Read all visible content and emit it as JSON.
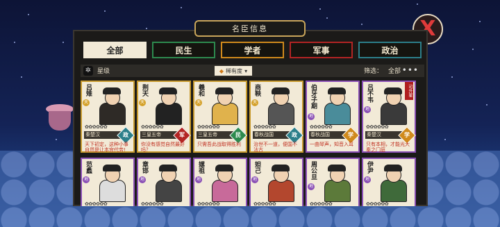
{
  "title": "名臣信息",
  "tabs": [
    {
      "label": "全部",
      "active": true,
      "color": "#f2ead7"
    },
    {
      "label": "民生",
      "active": false,
      "color": "#2d8a4e"
    },
    {
      "label": "学者",
      "active": false,
      "color": "#d08a1c"
    },
    {
      "label": "军事",
      "active": false,
      "color": "#b32424"
    },
    {
      "label": "政治",
      "active": false,
      "color": "#2c7f8a"
    }
  ],
  "filter": {
    "star_label": "星级",
    "sort_label": "稀有度",
    "screen_label": "筛选：",
    "screen_value": "全部",
    "more": "•••"
  },
  "cards": [
    {
      "name": "吕雉",
      "grade": "天",
      "period": "秦楚汉",
      "category": "政",
      "quote": "天下初定，这种小事自然是让本宫代劳!",
      "border": "#c79a2e",
      "cat_color": "#2c7f8a",
      "robe": "#2e2a26",
      "stars": "✿✿✿✿✿✿",
      "ribbon": ""
    },
    {
      "name": "荆天",
      "grade": "天",
      "period": "三皇五帝",
      "category": "军",
      "quote": "你没有感觉自然最好吗？",
      "border": "#c79a2e",
      "cat_color": "#b32424",
      "robe": "#222",
      "stars": "✿✿✿✿✿✿",
      "ribbon": ""
    },
    {
      "name": "羲和",
      "grade": "天",
      "period": "三皇五帝",
      "category": "民",
      "quote": "只需吾此战取得胜利",
      "border": "#c79a2e",
      "cat_color": "#2d8a4e",
      "robe": "#e0b24c",
      "stars": "✿✿✿✿✿✿",
      "ribbon": ""
    },
    {
      "name": "商鞅",
      "grade": "天",
      "period": "春秋战国",
      "category": "政",
      "quote": "治世不一道，便国不法古",
      "border": "#c79a2e",
      "cat_color": "#2c7f8a",
      "robe": "#555",
      "stars": "✿✿✿✿✿✿",
      "ribbon": ""
    },
    {
      "name": "伯牙子期",
      "grade": "地",
      "period": "春秋战国",
      "category": "学",
      "quote": "一曲琴声，知音入耳",
      "border": "#8a4fb5",
      "cat_color": "#d08a1c",
      "robe": "#4a8c9a",
      "stars": "✿✿✿✿✿✿",
      "ribbon": ""
    },
    {
      "name": "吕不韦",
      "grade": "地",
      "period": "秦楚汉",
      "category": "学",
      "quote": "只有本相，才能光大秦之门庭",
      "border": "#8a4fb5",
      "cat_color": "#d08a1c",
      "robe": "#3a3a3a",
      "stars": "✿✿✿✿✿✿",
      "ribbon": "可升星"
    },
    {
      "name": "范蠡",
      "grade": "地",
      "period": "",
      "category": "",
      "quote": "",
      "border": "#8a4fb5",
      "cat_color": "#2c7f8a",
      "robe": "#ddd",
      "stars": "✿✿✿✿✿✿",
      "ribbon": ""
    },
    {
      "name": "章邯",
      "grade": "地",
      "period": "",
      "category": "",
      "quote": "",
      "border": "#8a4fb5",
      "cat_color": "#b32424",
      "robe": "#444",
      "stars": "✿✿✿✿✿✿",
      "ribbon": ""
    },
    {
      "name": "嫘祖",
      "grade": "地",
      "period": "",
      "category": "",
      "quote": "",
      "border": "#8a4fb5",
      "cat_color": "#2d8a4e",
      "robe": "#c86a9a",
      "stars": "✿✿✿✿✿✿",
      "ribbon": ""
    },
    {
      "name": "妲己",
      "grade": "地",
      "period": "",
      "category": "",
      "quote": "",
      "border": "#8a4fb5",
      "cat_color": "#2c7f8a",
      "robe": "#b3472e",
      "stars": "✿✿✿✿✿✿",
      "ribbon": ""
    },
    {
      "name": "周公旦",
      "grade": "地",
      "period": "",
      "category": "",
      "quote": "",
      "border": "#8a4fb5",
      "cat_color": "#2c7f8a",
      "robe": "#5c7a3a",
      "stars": "✿✿✿✿✿✿",
      "ribbon": ""
    },
    {
      "name": "伊尹",
      "grade": "地",
      "period": "",
      "category": "",
      "quote": "",
      "border": "#8a4fb5",
      "cat_color": "#2c7f8a",
      "robe": "#3f6a3a",
      "stars": "✿✿✿✿✿✿",
      "ribbon": ""
    }
  ],
  "close_label": "X"
}
